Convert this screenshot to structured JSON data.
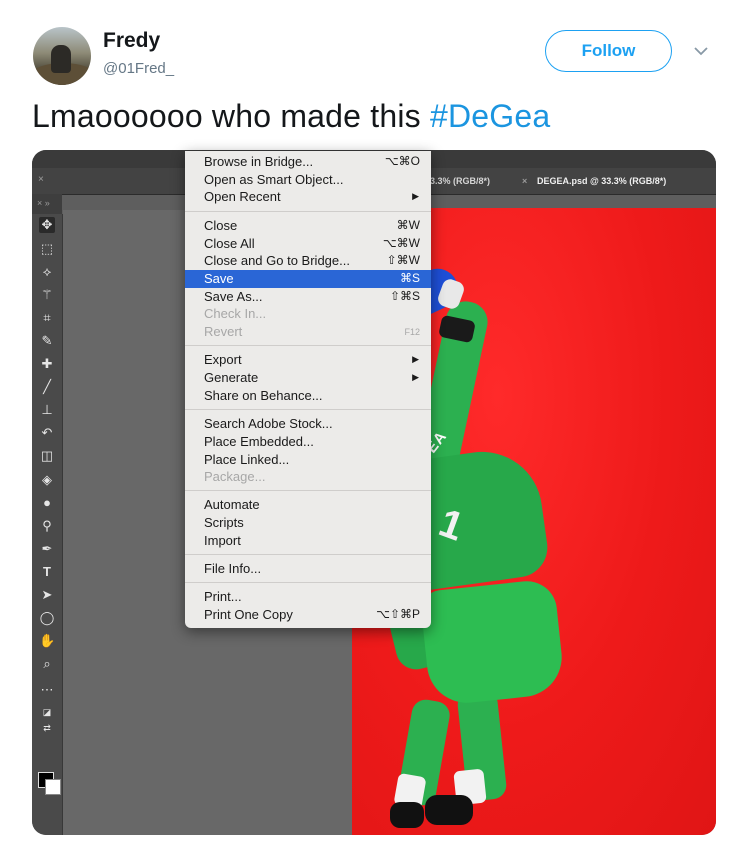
{
  "tweet": {
    "display_name": "Fredy",
    "handle": "@01Fred_",
    "follow_label": "Follow",
    "text_plain": "Lmaoooooo who made this ",
    "hashtag": "#DeGea",
    "colors": {
      "accent": "#1da1f2",
      "hashtag": "#1b95e0",
      "handle": "#657786"
    }
  },
  "photoshop": {
    "tabs": [
      {
        "label": "3.3% (RGB/8*)"
      },
      {
        "label": "DEGEA.psd @ 33.3% (RGB/8*)"
      }
    ],
    "tab_close": "×",
    "tools": [
      "move-tool",
      "marquee-tool",
      "lasso-tool",
      "magic-wand-tool",
      "crop-tool",
      "eyedropper-tool",
      "healing-brush-tool",
      "brush-tool",
      "clone-stamp-tool",
      "history-brush-tool",
      "eraser-tool",
      "paint-bucket-tool",
      "blur-tool",
      "dodge-tool",
      "pen-tool",
      "type-tool",
      "path-selection-tool",
      "ellipse-tool",
      "hand-tool",
      "zoom-tool",
      "more-tools"
    ],
    "file_menu": [
      {
        "label": "Browse in Bridge...",
        "shortcut": "⌥⌘O"
      },
      {
        "label": "Open as Smart Object...",
        "shortcut": ""
      },
      {
        "label": "Open Recent",
        "submenu": true
      },
      {
        "label": "Close",
        "shortcut": "⌘W"
      },
      {
        "label": "Close All",
        "shortcut": "⌥⌘W"
      },
      {
        "label": "Close and Go to Bridge...",
        "shortcut": "⇧⌘W"
      },
      {
        "label": "Save",
        "shortcut": "⌘S",
        "highlighted": true
      },
      {
        "label": "Save As...",
        "shortcut": "⇧⌘S"
      },
      {
        "label": "Check In...",
        "disabled": true
      },
      {
        "label": "Revert",
        "shortcut": "F12",
        "disabled": true
      },
      {
        "label": "Export",
        "submenu": true
      },
      {
        "label": "Generate",
        "submenu": true
      },
      {
        "label": "Share on Behance..."
      },
      {
        "label": "Search Adobe Stock..."
      },
      {
        "label": "Place Embedded..."
      },
      {
        "label": "Place Linked..."
      },
      {
        "label": "Package...",
        "disabled": true
      },
      {
        "label": "Automate"
      },
      {
        "label": "Scripts"
      },
      {
        "label": "Import"
      },
      {
        "label": "File Info..."
      },
      {
        "label": "Print..."
      },
      {
        "label": "Print One Copy",
        "shortcut": "⌥⇧⌘P"
      }
    ],
    "canvas": {
      "shirt_text": "DE GEA",
      "shirt_number": "1",
      "background_color": "#ee1a1a",
      "kit_color": "#27a84a"
    }
  }
}
